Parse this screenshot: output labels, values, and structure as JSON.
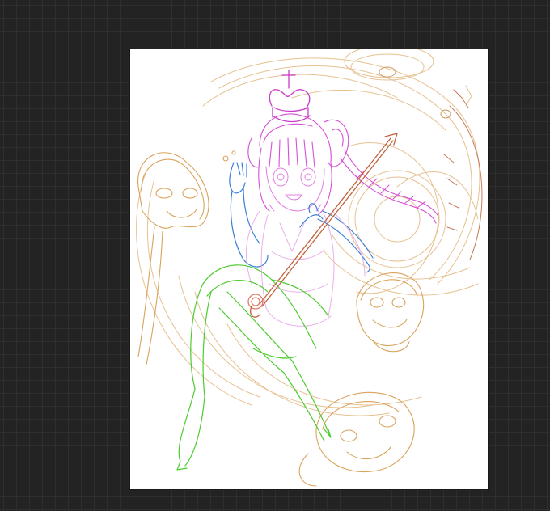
{
  "app": {
    "workspace_background": "#232323",
    "grid_line_color": "#2e2e2e",
    "canvas_background": "#ffffff"
  },
  "sketch": {
    "layer_colors": {
      "ghosts_and_effects": "#d9a35c",
      "hair_and_crown": "#d64fd6",
      "arms": "#3a7fd6",
      "legs": "#4ecb2f",
      "dress": "#e6a3e6",
      "staff": "#c0623c",
      "serpent": "#e0b07a"
    },
    "icons": [
      "crown-icon",
      "ghost-icon",
      "staff-icon"
    ]
  }
}
